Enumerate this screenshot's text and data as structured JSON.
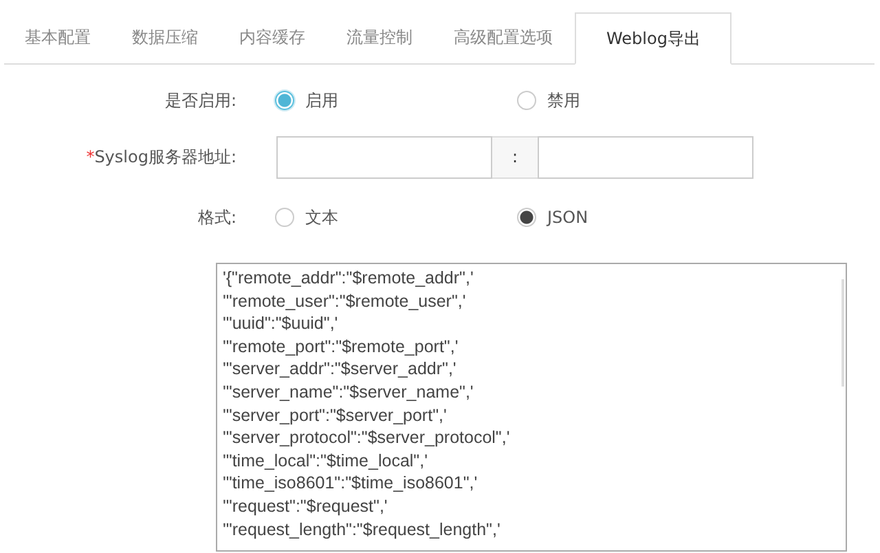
{
  "tabs": [
    {
      "label": "基本配置",
      "selected": false
    },
    {
      "label": "数据压缩",
      "selected": false
    },
    {
      "label": "内容缓存",
      "selected": false
    },
    {
      "label": "流量控制",
      "selected": false
    },
    {
      "label": "高级配置选项",
      "selected": false
    },
    {
      "label": "Weblog导出",
      "selected": true
    }
  ],
  "enable": {
    "label": "是否启用:",
    "options": [
      {
        "label": "启用",
        "selected": true
      },
      {
        "label": "禁用",
        "selected": false
      }
    ]
  },
  "syslog": {
    "required_mark": "*",
    "label": "Syslog服务器地址:",
    "separator": ":"
  },
  "format": {
    "label": "格式:",
    "options": [
      {
        "label": "文本",
        "selected": false
      },
      {
        "label": "JSON",
        "selected": true
      }
    ]
  },
  "template_lines": [
    "'{\"remote_addr\":\"$remote_addr\",'",
    "'\"remote_user\":\"$remote_user\",'",
    "'\"uuid\":\"$uuid\",'",
    "'\"remote_port\":\"$remote_port\",'",
    "'\"server_addr\":\"$server_addr\",'",
    "'\"server_name\":\"$server_name\",'",
    "'\"server_port\":\"$server_port\",'",
    "'\"server_protocol\":\"$server_protocol\",'",
    "'\"time_local\":\"$time_local\",'",
    "'\"time_iso8601\":\"$time_iso8601\",'",
    "'\"request\":\"$request\",'",
    "'\"request_length\":\"$request_length\",'"
  ]
}
